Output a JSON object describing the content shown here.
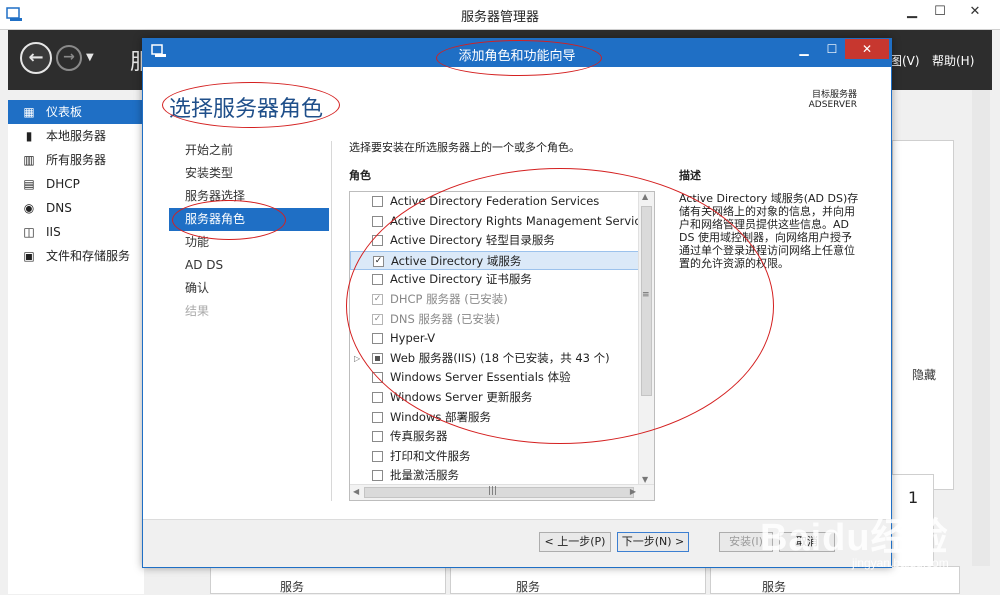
{
  "server_manager": {
    "title": "服务器管理器",
    "header_crumb": "服",
    "menus": {
      "view": "图(V)",
      "help": "帮助(H)"
    },
    "nav": [
      {
        "label": "仪表板",
        "icon": "dashboard-icon",
        "selected": true
      },
      {
        "label": "本地服务器",
        "icon": "server-icon",
        "selected": false
      },
      {
        "label": "所有服务器",
        "icon": "servers-icon",
        "selected": false
      },
      {
        "label": "DHCP",
        "icon": "dhcp-icon",
        "selected": false
      },
      {
        "label": "DNS",
        "icon": "dns-icon",
        "selected": false
      },
      {
        "label": "IIS",
        "icon": "iis-icon",
        "selected": false
      },
      {
        "label": "文件和存储服务",
        "icon": "storage-icon",
        "selected": false
      }
    ],
    "right_pane": {
      "hide_label": "隐藏",
      "tile_count": "1"
    },
    "bottom_labels": [
      "服务",
      "服务",
      "服务"
    ]
  },
  "wizard": {
    "title": "添加角色和功能向导",
    "heading": "选择服务器角色",
    "target_label": "目标服务器",
    "target_value": "ADSERVER",
    "steps": [
      {
        "label": "开始之前",
        "state": "normal"
      },
      {
        "label": "安装类型",
        "state": "normal"
      },
      {
        "label": "服务器选择",
        "state": "normal"
      },
      {
        "label": "服务器角色",
        "state": "active"
      },
      {
        "label": "功能",
        "state": "normal"
      },
      {
        "label": "AD DS",
        "state": "normal"
      },
      {
        "label": "确认",
        "state": "normal"
      },
      {
        "label": "结果",
        "state": "disabled"
      }
    ],
    "instruction": "选择要安装在所选服务器上的一个或多个角色。",
    "roles_header": "角色",
    "description_header": "描述",
    "description": "Active Directory 域服务(AD DS)存储有关网络上的对象的信息，并向用户和网络管理员提供这些信息。AD DS 使用域控制器，向网络用户授予通过单个登录进程访问网络上任意位置的允许资源的权限。",
    "roles": [
      {
        "label": "Active Directory Federation Services",
        "check": "unchecked",
        "installed": false,
        "expandable": false
      },
      {
        "label": "Active Directory Rights Management Services",
        "check": "unchecked",
        "installed": false,
        "expandable": false
      },
      {
        "label": "Active Directory 轻型目录服务",
        "check": "unchecked",
        "installed": false,
        "expandable": false
      },
      {
        "label": "Active Directory 域服务",
        "check": "checked",
        "installed": false,
        "expandable": false,
        "selected": true
      },
      {
        "label": "Active Directory 证书服务",
        "check": "unchecked",
        "installed": false,
        "expandable": false
      },
      {
        "label": "DHCP 服务器 (已安装)",
        "check": "checked",
        "installed": true,
        "expandable": false
      },
      {
        "label": "DNS 服务器 (已安装)",
        "check": "checked",
        "installed": true,
        "expandable": false
      },
      {
        "label": "Hyper-V",
        "check": "unchecked",
        "installed": false,
        "expandable": false
      },
      {
        "label": "Web 服务器(IIS) (18 个已安装，共 43 个)",
        "check": "partial",
        "installed": false,
        "expandable": true
      },
      {
        "label": "Windows Server Essentials 体验",
        "check": "unchecked",
        "installed": false,
        "expandable": false
      },
      {
        "label": "Windows Server 更新服务",
        "check": "unchecked",
        "installed": false,
        "expandable": false
      },
      {
        "label": "Windows 部署服务",
        "check": "unchecked",
        "installed": false,
        "expandable": false
      },
      {
        "label": "传真服务器",
        "check": "unchecked",
        "installed": false,
        "expandable": false
      },
      {
        "label": "打印和文件服务",
        "check": "unchecked",
        "installed": false,
        "expandable": false
      },
      {
        "label": "批量激活服务",
        "check": "unchecked",
        "installed": false,
        "expandable": false
      }
    ],
    "buttons": {
      "prev": "< 上一步(P)",
      "next": "下一步(N) >",
      "install": "安装(I)",
      "cancel": "取消"
    }
  },
  "watermark": {
    "brand": "Baidu经验",
    "url": "jingyan.baidu.com"
  },
  "colors": {
    "accent": "#1f6fc5",
    "annotation": "#d42020",
    "header_bg": "#2d2d2d"
  }
}
